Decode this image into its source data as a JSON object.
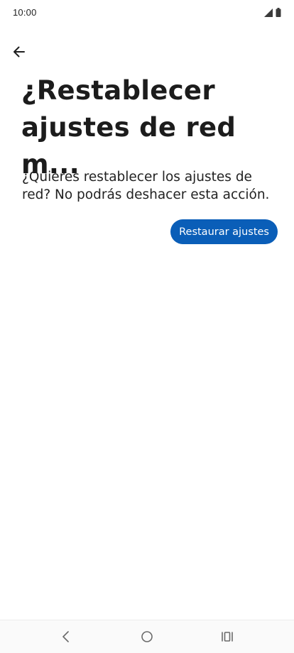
{
  "status_bar": {
    "time": "10:00"
  },
  "header": {
    "back_icon": "arrow-left-icon",
    "title": "¿Restablecer ajustes de red m..."
  },
  "main": {
    "description": "¿Quieres restablecer los ajustes de red? No podrás deshacer esta acción.",
    "action_button_label": "Restaurar ajustes"
  },
  "colors": {
    "accent": "#0A5EB8",
    "background": "#FFFFFF",
    "text": "#1C1C1C"
  },
  "nav_bar": {
    "icons": [
      "nav-back-icon",
      "nav-home-icon",
      "nav-recents-icon"
    ]
  }
}
